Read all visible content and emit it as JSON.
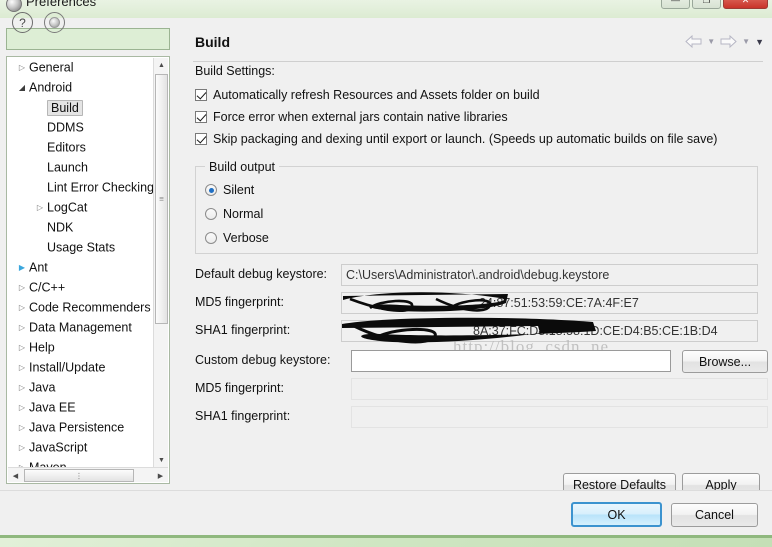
{
  "window": {
    "title": "Preferences",
    "icon": "preferences-icon",
    "controls": [
      {
        "name": "minimize",
        "glyph": "—"
      },
      {
        "name": "maximize",
        "glyph": "❐"
      },
      {
        "name": "close",
        "glyph": "✕"
      }
    ]
  },
  "sidebar": {
    "filter": {
      "value": "",
      "placeholder": ""
    },
    "tree": [
      {
        "label": "General",
        "indent": 0,
        "arrow": "collapsed",
        "selected": false
      },
      {
        "label": "Android",
        "indent": 0,
        "arrow": "expanded",
        "selected": false
      },
      {
        "label": "Build",
        "indent": 1,
        "arrow": "none",
        "selected": true
      },
      {
        "label": "DDMS",
        "indent": 1,
        "arrow": "none",
        "selected": false
      },
      {
        "label": "Editors",
        "indent": 1,
        "arrow": "none",
        "selected": false
      },
      {
        "label": "Launch",
        "indent": 1,
        "arrow": "none",
        "selected": false
      },
      {
        "label": "Lint Error Checking",
        "indent": 1,
        "arrow": "none",
        "selected": false
      },
      {
        "label": "LogCat",
        "indent": 1,
        "arrow": "collapsed",
        "selected": false
      },
      {
        "label": "NDK",
        "indent": 1,
        "arrow": "none",
        "selected": false
      },
      {
        "label": "Usage Stats",
        "indent": 1,
        "arrow": "none",
        "selected": false
      },
      {
        "label": "Ant",
        "indent": 0,
        "arrow": "collapsed-blue",
        "selected": false
      },
      {
        "label": "C/C++",
        "indent": 0,
        "arrow": "collapsed",
        "selected": false
      },
      {
        "label": "Code Recommenders",
        "indent": 0,
        "arrow": "collapsed",
        "selected": false
      },
      {
        "label": "Data Management",
        "indent": 0,
        "arrow": "collapsed",
        "selected": false
      },
      {
        "label": "Help",
        "indent": 0,
        "arrow": "collapsed",
        "selected": false
      },
      {
        "label": "Install/Update",
        "indent": 0,
        "arrow": "collapsed",
        "selected": false
      },
      {
        "label": "Java",
        "indent": 0,
        "arrow": "collapsed",
        "selected": false
      },
      {
        "label": "Java EE",
        "indent": 0,
        "arrow": "collapsed",
        "selected": false
      },
      {
        "label": "Java Persistence",
        "indent": 0,
        "arrow": "collapsed",
        "selected": false
      },
      {
        "label": "JavaScript",
        "indent": 0,
        "arrow": "collapsed",
        "selected": false
      },
      {
        "label": "Maven",
        "indent": 0,
        "arrow": "collapsed",
        "selected": false
      }
    ]
  },
  "page": {
    "title": "Build",
    "nav": {
      "back_icon": "back-arrow-icon",
      "back_menu_icon": "chevron-down-icon",
      "forward_icon": "forward-arrow-icon",
      "forward_menu_icon": "chevron-down-icon",
      "menu_icon": "view-menu-chevron-icon"
    },
    "settings_label": "Build Settings:",
    "checkboxes": [
      {
        "label": "Automatically refresh Resources and Assets folder on build",
        "checked": true
      },
      {
        "label": "Force error when external jars contain native libraries",
        "checked": true
      },
      {
        "label": "Skip packaging and dexing until export or launch. (Speeds up automatic builds on file save)",
        "checked": true
      }
    ],
    "build_output": {
      "legend": "Build output",
      "options": [
        {
          "label": "Silent",
          "selected": true
        },
        {
          "label": "Normal",
          "selected": false
        },
        {
          "label": "Verbose",
          "selected": false
        }
      ]
    },
    "fields": [
      {
        "label": "Default debug keystore:",
        "value": "C:\\Users\\Administrator\\.android\\debug.keystore",
        "readonly": true,
        "redacted": false
      },
      {
        "label": "MD5 fingerprint:",
        "value": "24:87:51:53:59:CE:7A:4F:E7",
        "readonly": true,
        "redacted": true
      },
      {
        "label": "SHA1 fingerprint:",
        "value": "8A:37:FC:D8:18:58:1D:CE:D4:B5:CE:1B:D4",
        "readonly": true,
        "redacted": true
      },
      {
        "label": "Custom debug keystore:",
        "value": "",
        "readonly": false,
        "redacted": false
      },
      {
        "label": "MD5 fingerprint:",
        "value": "",
        "readonly": true,
        "redacted": false
      },
      {
        "label": "SHA1 fingerprint:",
        "value": "",
        "readonly": true,
        "redacted": false
      }
    ],
    "browse_label": "Browse...",
    "watermark": "http://blog. csdn. ne",
    "restore_defaults_label": "Restore Defaults",
    "apply_label": "Apply"
  },
  "footer": {
    "help_icon": "question-mark-icon",
    "restore_icon": "restore-window-icon",
    "ok_label": "OK",
    "cancel_label": "Cancel"
  },
  "colors": {
    "accent": "#3c93cf",
    "desktop": "#cfe6c4",
    "dialog_bg": "#f0f0f0",
    "close_button": "#c9342a"
  }
}
